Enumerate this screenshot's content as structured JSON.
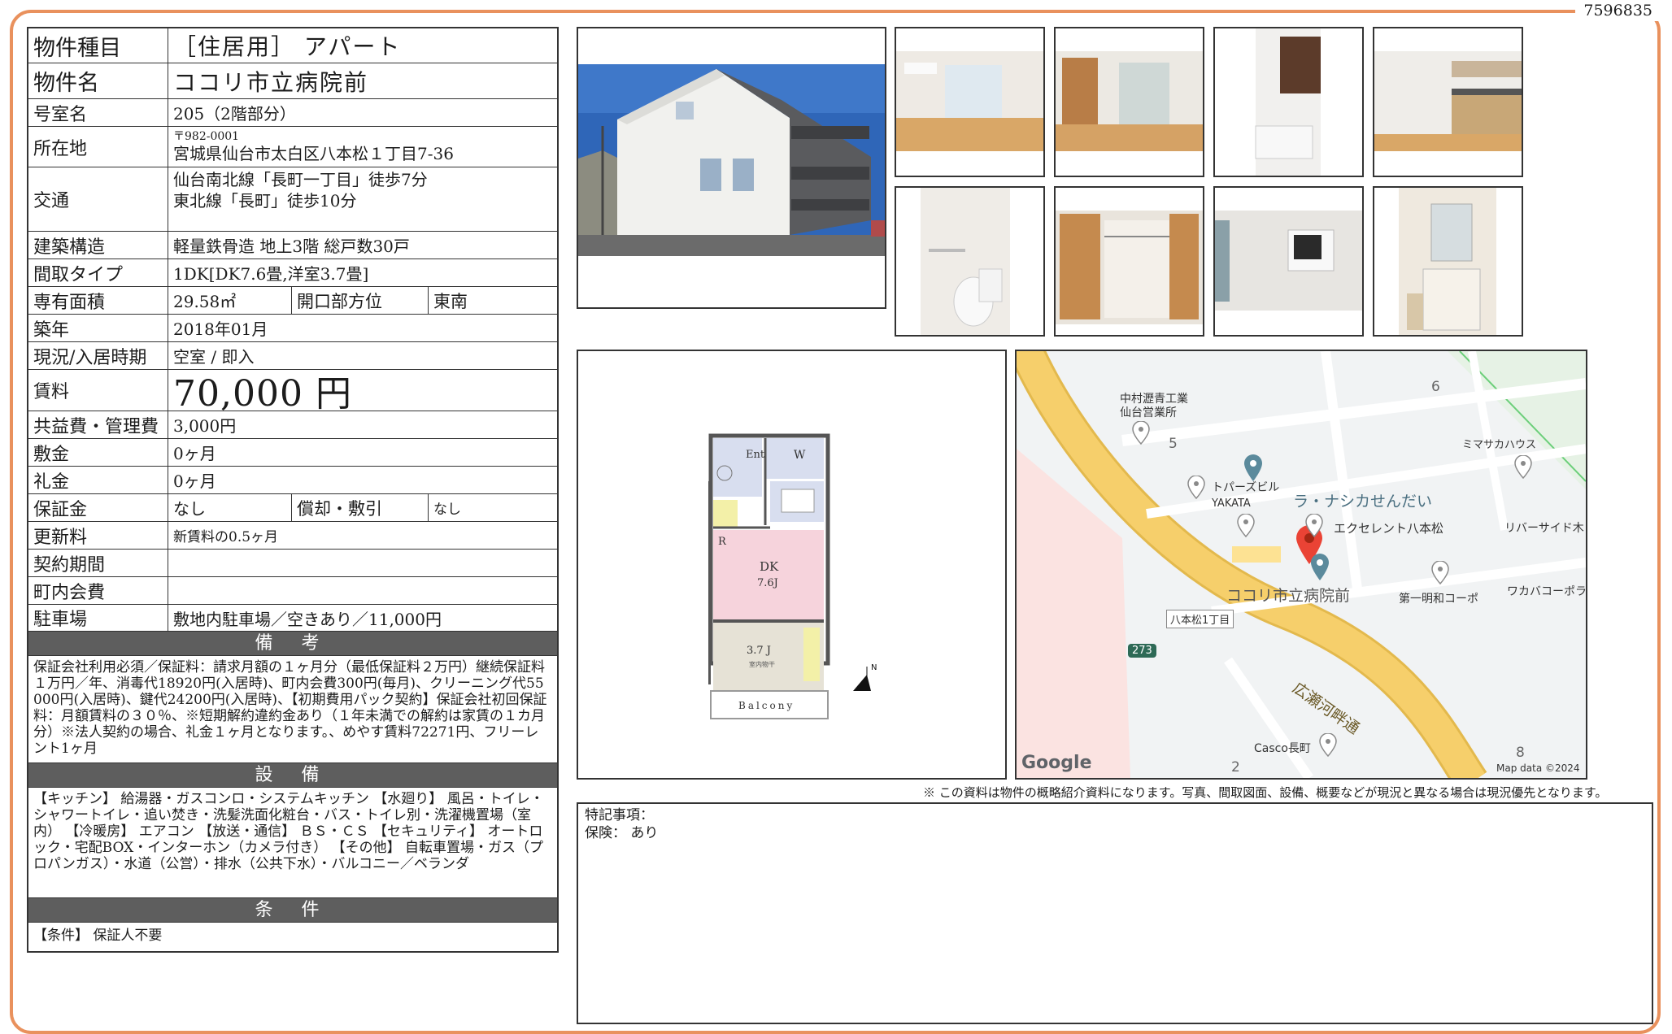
{
  "doc_id": "7596835",
  "property": {
    "type_label": "物件種目",
    "type_value": "［住居用］ アパート",
    "name_label": "物件名",
    "name_value": "ココリ市立病院前",
    "room_label": "号室名",
    "room_value": "205（2階部分）",
    "address_label": "所在地",
    "postal": "〒982-0001",
    "address": "宮城県仙台市太白区八本松１丁目7-36",
    "transport_label": "交通",
    "transport_1": "仙台南北線「長町一丁目」徒歩7分",
    "transport_2": "東北線「長町」徒歩10分",
    "structure_label": "建築構造",
    "structure_value": "軽量鉄骨造 地上3階 総戸数30戸",
    "layout_label": "間取タイプ",
    "layout_value": "1DK[DK7.6畳,洋室3.7畳]",
    "area_label": "専有面積",
    "area_value": "29.58㎡",
    "facing_label": "開口部方位",
    "facing_value": "東南",
    "built_label": "築年",
    "built_value": "2018年01月",
    "status_label": "現況/入居時期",
    "status_value": "空室 / 即入",
    "rent_label": "賃料",
    "rent_value": "70,000 円",
    "fee_label": "共益費・管理費",
    "fee_value": "3,000円",
    "deposit_label": "敷金",
    "deposit_value": "0ヶ月",
    "key_money_label": "礼金",
    "key_money_value": "0ヶ月",
    "guarantee_label": "保証金",
    "guarantee_value": "なし",
    "amort_label": "償却・敷引",
    "amort_value": "なし",
    "renewal_label": "更新料",
    "renewal_value": "新賃料の0.5ヶ月",
    "contract_label": "契約期間",
    "contract_value": "",
    "community_label": "町内会費",
    "community_value": "",
    "parking_label": "駐車場",
    "parking_value": "敷地内駐車場／空きあり／11,000円"
  },
  "remarks": {
    "title": "備 考",
    "text": "保証会社利用必須／保証料：請求月額の１ヶ月分（最低保証料２万円）継続保証料１万円／年、消毒代18920円(入居時)、町内会費300円(毎月)、クリーニング代55000円(入居時)、鍵代24200円(入居時)、【初期費用パック契約】保証会社初回保証料：月額賃料の３０％、※短期解約違約金あり（１年未満での解約は家賃の１カ月分）※法人契約の場合、礼金１ヶ月となります。、めやす賃料72271円、フリーレント1ヶ月"
  },
  "equipment": {
    "title": "設 備",
    "text": "【キッチン】 給湯器・ガスコンロ・システムキッチン 【水廻り】 風呂・トイレ・シャワートイレ・追い焚き・洗髪洗面化粧台・バス・トイレ別・洗濯機置場（室内） 【冷暖房】 エアコン 【放送・通信】 ＢＳ・ＣＳ 【セキュリティ】 オートロック・宅配BOX・インターホン（カメラ付き） 【その他】 自転車置場・ガス（プロパンガス）・水道（公営）・排水（公共下水）・バルコニー／ベランダ"
  },
  "conditions": {
    "title": "条 件",
    "text": "【条件】 保証人不要"
  },
  "floorplan": {
    "ent": "Ent",
    "w": "W",
    "r": "R",
    "dk_name": "DK",
    "dk_size": "7.6J",
    "room_size": "3.7 J",
    "room_note": "室内物干",
    "balcony": "Balcony",
    "north": "N"
  },
  "map": {
    "labels": [
      "中村瀝青工業",
      "仙台営業所",
      "ミマサカハウス",
      "トパーズビル",
      "YAKATA",
      "ラ・ナシカせんだい",
      "エクセレント八本松",
      "リバーサイド木",
      "ココリ市立病院前",
      "第一明和コーポ",
      "ワカバコーポラ",
      "八本松1丁目",
      "273",
      "広瀬河畔通",
      "Casco長町",
      "Google",
      "Map data ©2024",
      "5",
      "6",
      "2",
      "8"
    ]
  },
  "disclaimer": "※ この資料は物件の概略紹介資料になります。写真、間取図面、設備、概要などが現況と異なる場合は現況優先となります。",
  "notes": {
    "line1": "特記事項：",
    "line2": "保険： あり"
  },
  "colors": {
    "frame": "#e9915d",
    "section_header": "#5e5e5e",
    "pin": "#ea4335",
    "road": "#f6cf6b"
  }
}
